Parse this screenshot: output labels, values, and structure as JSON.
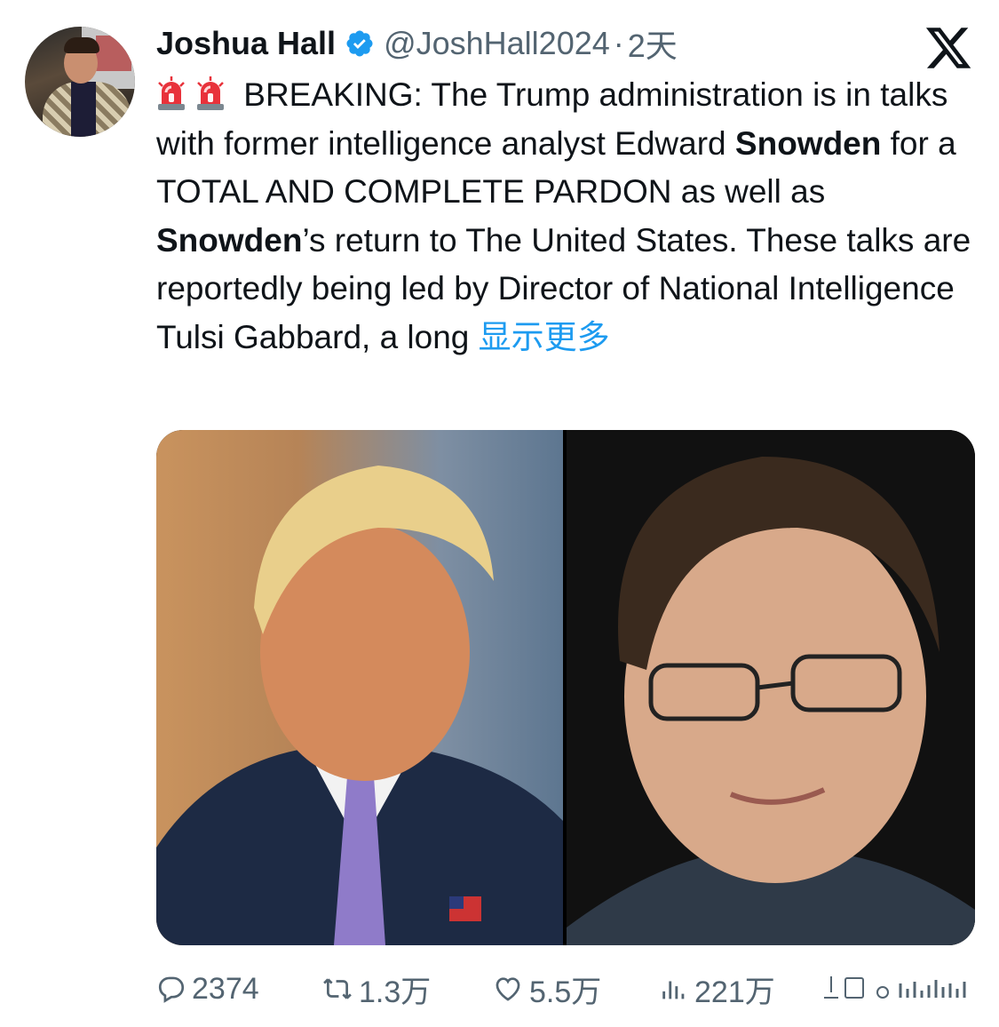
{
  "author": {
    "name": "Joshua Hall",
    "handle": "@JoshHall2024",
    "separator": "·",
    "time": "2天"
  },
  "tweet": {
    "segments": [
      {
        "text": " BREAKING: The Trump administration is in talks with former intelligence analyst Edward ",
        "bold": false
      },
      {
        "text": "Snowden",
        "bold": true
      },
      {
        "text": " for a TOTAL AND COMPLETE PARDON as well as ",
        "bold": false
      },
      {
        "text": "Snowden",
        "bold": true
      },
      {
        "text": "’s return to The United States. These talks are reportedly being led by Director of National Intelligence Tulsi Gabbard, a long ",
        "bold": false
      }
    ],
    "show_more": "显示更多"
  },
  "stats": {
    "replies": "2374",
    "retweets": "1.3万",
    "likes": "5.5万",
    "views": "221万"
  },
  "icons": {
    "siren": "police-light-icon",
    "verified": "verified-badge-icon",
    "logo": "x-logo-icon"
  },
  "colors": {
    "accent": "#1d9bf0",
    "muted": "#536471",
    "text": "#0f1419"
  }
}
